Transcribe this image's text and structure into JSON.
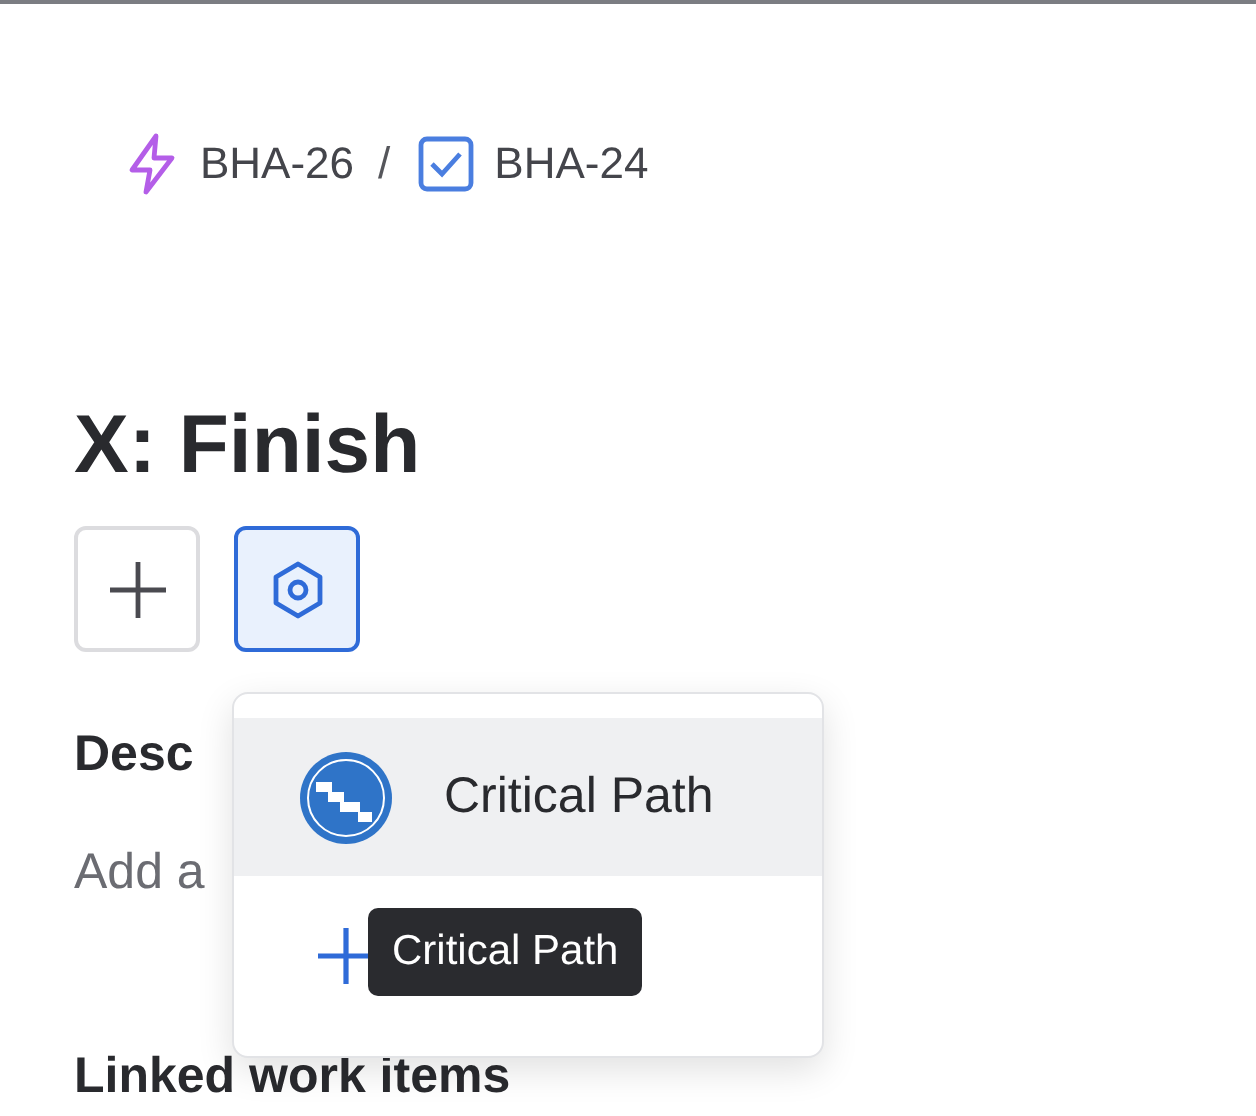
{
  "breadcrumb": [
    {
      "kind": "epic",
      "label": "BHA-26"
    },
    {
      "kind": "task",
      "label": "BHA-24"
    }
  ],
  "breadcrumb_separator": "/",
  "title": "X: Finish",
  "toolbar": [
    {
      "kind": "add",
      "selected": false
    },
    {
      "kind": "apps",
      "selected": true
    }
  ],
  "description": {
    "heading": "Desc",
    "placeholder": "Add a"
  },
  "linked_heading": "Linked work items",
  "apps_menu": {
    "items": [
      {
        "label": "Critical Path",
        "selected": true
      }
    ],
    "add_tooltip": "Critical Path"
  }
}
